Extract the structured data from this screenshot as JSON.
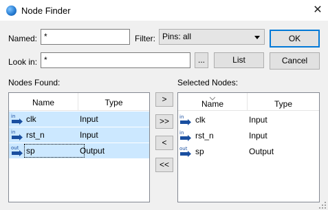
{
  "window": {
    "title": "Node Finder",
    "close_glyph": "✕"
  },
  "named": {
    "label": "Named:",
    "value": "*"
  },
  "filter": {
    "label": "Filter:",
    "value": "Pins: all"
  },
  "look_in": {
    "label": "Look in:",
    "value": "*"
  },
  "buttons": {
    "ok": "OK",
    "cancel": "Cancel",
    "list": "List",
    "browse": "...",
    "move_right": ">",
    "move_all_right": ">>",
    "move_left": "<",
    "move_all_left": "<<"
  },
  "nodes_found": {
    "label": "Nodes Found:",
    "columns": [
      "Name",
      "Type"
    ],
    "rows": [
      {
        "dir": "in",
        "name": "clk",
        "type": "Input"
      },
      {
        "dir": "in",
        "name": "rst_n",
        "type": "Input"
      },
      {
        "dir": "out",
        "name": "sp",
        "type": "Output"
      }
    ]
  },
  "selected_nodes": {
    "label": "Selected Nodes:",
    "columns": [
      "Name",
      "Type"
    ],
    "rows": [
      {
        "dir": "in",
        "name": "clk",
        "type": "Input"
      },
      {
        "dir": "in",
        "name": "rst_n",
        "type": "Input"
      },
      {
        "dir": "out",
        "name": "sp",
        "type": "Output"
      }
    ]
  },
  "colors": {
    "selection": "#cce8ff",
    "accent": "#0078d7",
    "pin": "#1a4fa0"
  }
}
